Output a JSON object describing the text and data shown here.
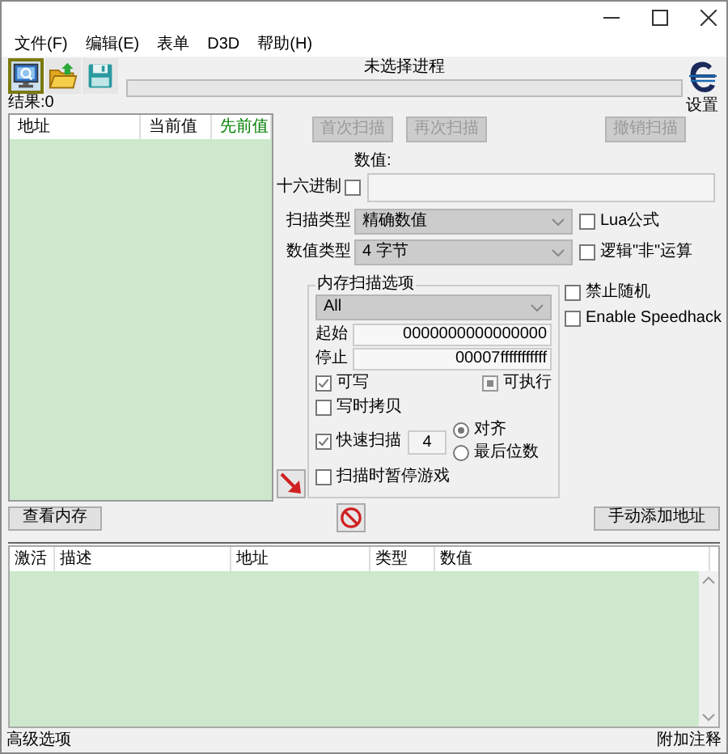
{
  "menu": [
    {
      "label": "文件(F)"
    },
    {
      "label": "编辑(E)"
    },
    {
      "label": "表单"
    },
    {
      "label": "D3D"
    },
    {
      "label": "帮助(H)"
    }
  ],
  "toolbar": {
    "tools": [
      {
        "kind": "process",
        "selected": true
      },
      {
        "kind": "open",
        "selected": false
      },
      {
        "kind": "save",
        "selected": false
      }
    ],
    "process": "未选择进程",
    "progress": {
      "level": 0
    },
    "settings": "设置"
  },
  "results": "结果:0",
  "found_list": {
    "columns": [
      {
        "label": "地址",
        "color": "#000000"
      },
      {
        "label": "当前值",
        "color": "#000000"
      },
      {
        "label": "先前值",
        "color": "#008000"
      }
    ]
  },
  "scan_buttons": [
    {
      "label": "首次扫描",
      "disabled": true
    },
    {
      "label": "再次扫描",
      "disabled": true
    },
    {
      "label": "撤销扫描",
      "disabled": true
    }
  ],
  "value": {
    "label": "数值:",
    "hex_label": "十六进制",
    "hex_checked": false
  },
  "scan_type": {
    "label": "扫描类型",
    "value": "精确数值"
  },
  "value_type": {
    "label": "数值类型",
    "value": "4 字节"
  },
  "side_options": [
    {
      "label": "Lua公式",
      "checked": false
    },
    {
      "label": "逻辑\"非\"运算",
      "checked": false
    },
    {
      "label": "禁止随机",
      "checked": false
    },
    {
      "label": "Enable Speedhack",
      "checked": false
    }
  ],
  "memory_options": {
    "title": "内存扫描选项",
    "region": "All",
    "start_label": "起始",
    "start": "0000000000000000",
    "stop_label": "停止",
    "stop": "00007fffffffffff",
    "permissions": [
      {
        "kind": "check",
        "label": "可写",
        "checked": true
      },
      {
        "kind": "tristate",
        "label": "可执行",
        "checked": true
      },
      {
        "kind": "check",
        "label": "写时拷贝",
        "checked": false
      }
    ],
    "fast_scan": {
      "label": "快速扫描",
      "checked": true,
      "value": "4"
    },
    "alignment": [
      {
        "label": "对齐",
        "selected": true
      },
      {
        "label": "最后位数",
        "selected": false
      }
    ],
    "pause": {
      "label": "扫描时暂停游戏",
      "checked": false
    }
  },
  "view_memory": "查看内存",
  "add_address": "手动添加地址",
  "address_list": {
    "columns": [
      "激活",
      "描述",
      "地址",
      "类型",
      "数值"
    ]
  },
  "status_bar": {
    "left": "高级选项",
    "right": "附加注释"
  }
}
